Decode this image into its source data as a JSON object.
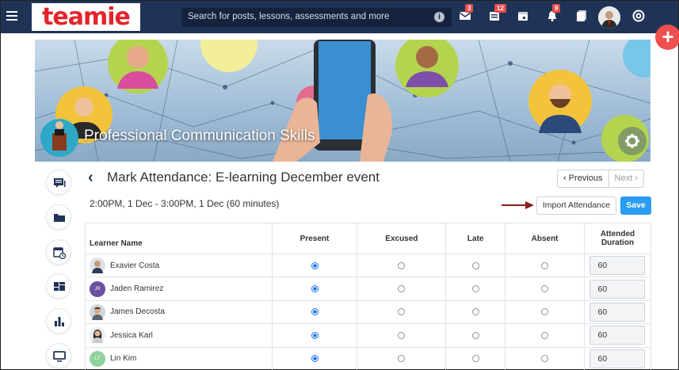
{
  "topbar": {
    "logo_text": "teamie",
    "search_placeholder": "Search for posts, lessons, assessments and more",
    "badges": {
      "mail": "3",
      "feed": "12",
      "notifications": "9"
    }
  },
  "banner": {
    "course_title": "Professional Communication Skills"
  },
  "header": {
    "back_label": "‹",
    "title": "Mark Attendance: E-learning December event",
    "previous_label": "‹ Previous",
    "next_label": "Next ›",
    "time": "2:00PM, 1 Dec - 3:00PM, 1 Dec (60 minutes)",
    "import_label": "Import Attendance",
    "save_label": "Save"
  },
  "table": {
    "headers": {
      "name": "Learner Name",
      "present": "Present",
      "excused": "Excused",
      "late": "Late",
      "absent": "Absent",
      "duration_line1": "Attended",
      "duration_line2": "Duration"
    },
    "rows": [
      {
        "name": "Exavier Costa",
        "initials": "",
        "status": "present",
        "duration": "60"
      },
      {
        "name": "Jaden Ramirez",
        "initials": "JR",
        "status": "present",
        "duration": "60"
      },
      {
        "name": "James Decosta",
        "initials": "",
        "status": "present",
        "duration": "60"
      },
      {
        "name": "Jessica Karl",
        "initials": "",
        "status": "present",
        "duration": "60"
      },
      {
        "name": "Lin Kim",
        "initials": "LT",
        "status": "present",
        "duration": "60"
      }
    ]
  },
  "colors": {
    "topbar": "#1f3357",
    "accent": "#2a9cf2",
    "fab": "#ef4f4f",
    "badge": "#e74c4c"
  }
}
